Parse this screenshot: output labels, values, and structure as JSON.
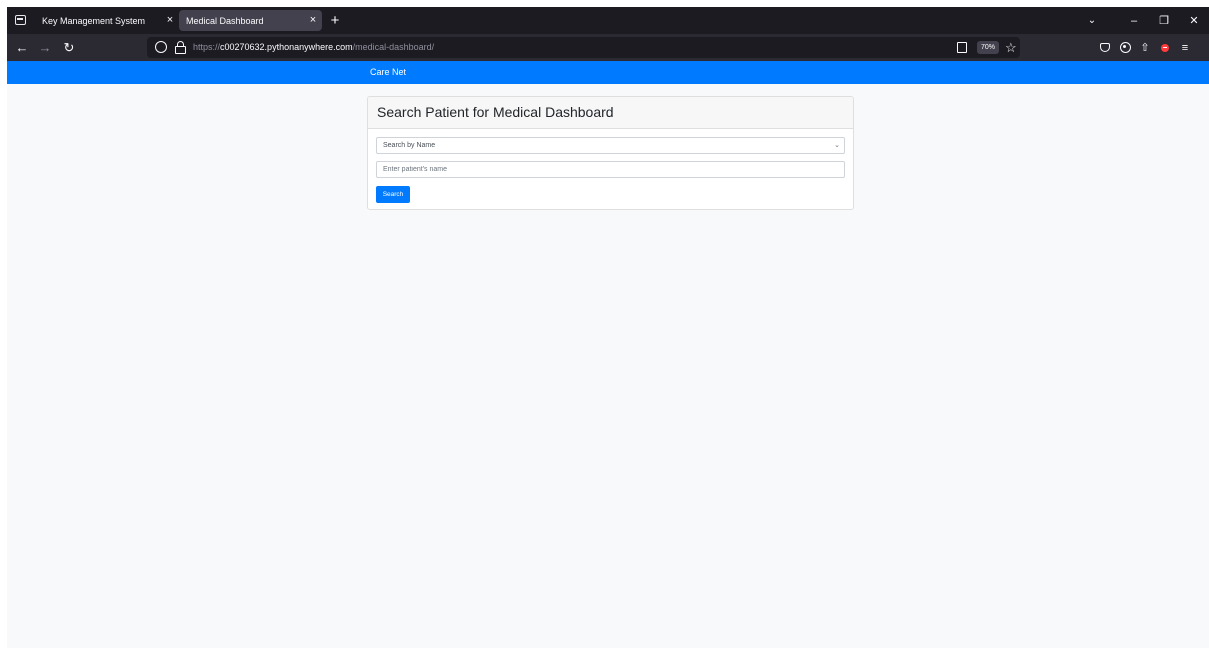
{
  "browser": {
    "tabs": [
      {
        "title": "Key Management System",
        "active": false
      },
      {
        "title": "Medical Dashboard",
        "active": true
      }
    ],
    "new_tab_label": "+",
    "close_glyph": "×",
    "url": {
      "scheme": "https://",
      "host": "c00270632.pythonanywhere.com",
      "path": "/medical-dashboard/"
    },
    "zoom": "70%",
    "icons": [
      "tab-overview-icon",
      "back-icon",
      "forward-icon",
      "reload-icon",
      "shield-icon",
      "lock-icon",
      "reader-view-icon",
      "bookmark-star-icon",
      "pocket-icon",
      "account-icon",
      "extensions-icon",
      "recording-icon",
      "menu-icon",
      "minimize-icon",
      "restore-icon",
      "close-icon"
    ]
  },
  "page": {
    "brand": "Care Net",
    "card_title": "Search Patient for Medical Dashboard",
    "search_type": {
      "selected": "Search by Name"
    },
    "name_input": {
      "value": "",
      "placeholder": "Enter patient's name"
    },
    "search_button": "Search"
  },
  "colors": {
    "primary": "#007bff",
    "browser_dark": "#1c1b22",
    "toolbar": "#2b2a33",
    "page_bg": "#f8f9fa"
  }
}
